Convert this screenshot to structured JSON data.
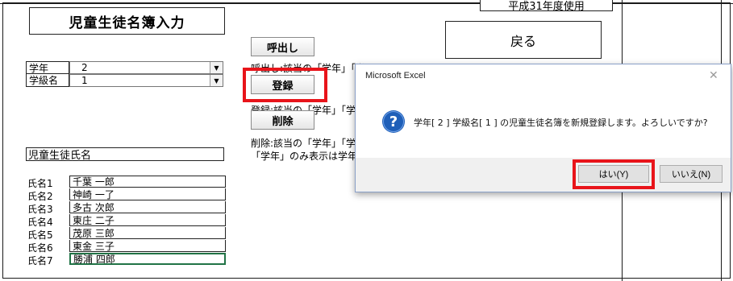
{
  "sheet": {
    "title": "児童生徒名簿入力",
    "corner_partial_text": "平成31年度使用",
    "back_button": "戻る",
    "grade_label": "学年",
    "grade_value": "2",
    "class_label": "学級名",
    "class_value": "1",
    "call_button": "呼出し",
    "call_desc": "呼出し:該当の「学年」「学",
    "register_button": "登録",
    "register_desc": "登録:該当の「学年」「学",
    "delete_button": "削除",
    "delete_desc": "削除:該当の「学年」「学",
    "delete_desc2": "「学年」のみ表示は学年",
    "students_header": "児童生徒氏名",
    "students": [
      {
        "label": "氏名1",
        "name": "千葉 一郎"
      },
      {
        "label": "氏名2",
        "name": "神崎 一了"
      },
      {
        "label": "氏名3",
        "name": "多古 次郎"
      },
      {
        "label": "氏名4",
        "name": "東庄 二子"
      },
      {
        "label": "氏名5",
        "name": "茂原 三郎"
      },
      {
        "label": "氏名6",
        "name": "東金 三子"
      },
      {
        "label": "氏名7",
        "name": "勝浦 四郎"
      }
    ]
  },
  "dialog": {
    "title": "Microsoft Excel",
    "close_icon": "close-icon",
    "icon": "question-icon",
    "message": "学年[ 2 ] 学級名[ 1 ] の児童生徒名簿を新規登録します。よろしいですか?",
    "yes_button": "はい(Y)",
    "no_button": "いいえ(N)"
  },
  "colors": {
    "highlight": "#e8141a",
    "question_icon": "#1f5fb8"
  }
}
